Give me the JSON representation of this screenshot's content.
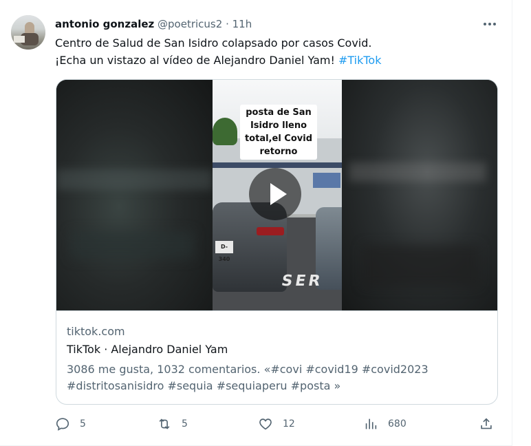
{
  "tweet": {
    "author_name": "antonio gonzalez",
    "handle": "@poetricus2",
    "separator": "·",
    "time": "11h",
    "text_line1": "Centro de Salud de San Isidro colapsado por casos Covid.",
    "text_line2_prefix": "¡Echa un vistazo al vídeo de Alejandro Daniel Yam! ",
    "text_hashtag": "#TikTok"
  },
  "card": {
    "video_caption": "posta de San Isidro lleno total,el Covid retorno",
    "plate_text": "D-340",
    "road_text": "SER",
    "domain": "tiktok.com",
    "title": "TikTok · Alejandro Daniel Yam",
    "desc_line1": "3086 me gusta, 1032 comentarios. «#covi #covid19 #covid2023",
    "desc_line2": "#distritosanisidro #sequia #sequiaperu #posta »"
  },
  "actions": {
    "replies": "5",
    "retweets": "5",
    "likes": "12",
    "views": "680"
  },
  "icons": [
    "more-icon",
    "play-icon",
    "reply-icon",
    "retweet-icon",
    "like-icon",
    "views-icon",
    "share-icon"
  ],
  "colors": {
    "accent": "#1d9bf0",
    "text": "#0f1419",
    "muted": "#536471",
    "border": "#cfd9de"
  }
}
